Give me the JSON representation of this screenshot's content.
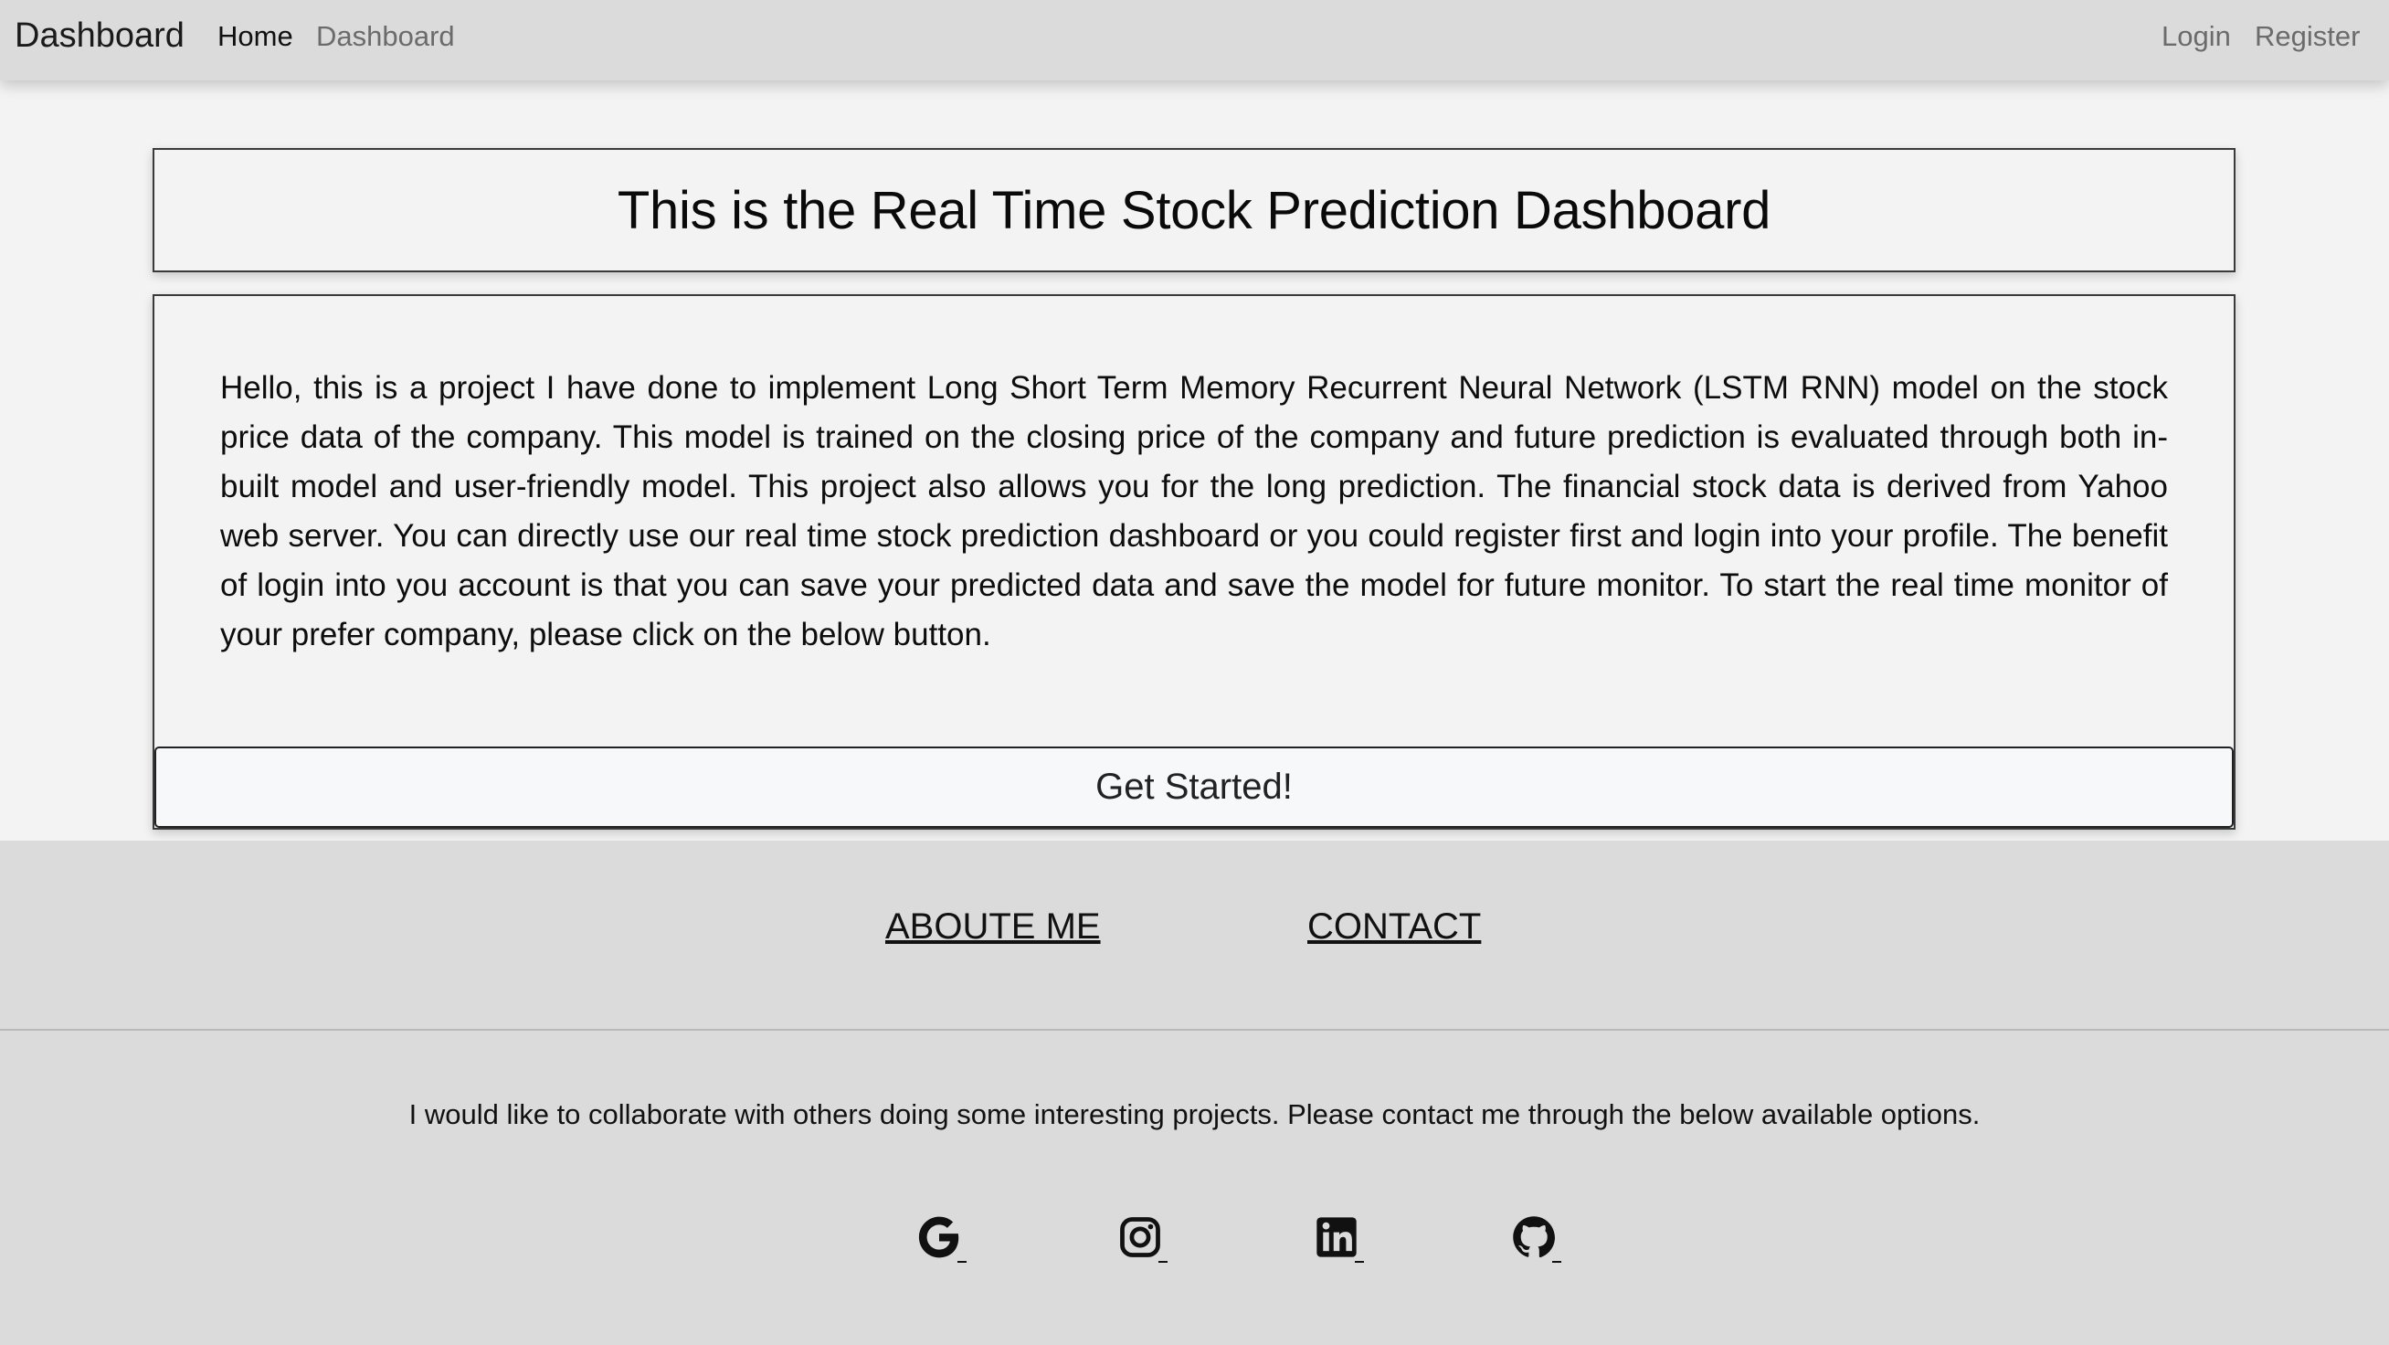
{
  "navbar": {
    "brand": "Dashboard",
    "links": [
      "Home",
      "Dashboard"
    ],
    "auth": [
      "Login",
      "Register"
    ]
  },
  "main": {
    "title": "This is the Real Time Stock Prediction Dashboard",
    "intro": "Hello, this is a project I have done to implement Long Short Term Memory Recurrent Neural Network (LSTM RNN) model on the stock price data of the company. This model is trained on the closing price of the company and future prediction is evaluated through both in-built model and user-friendly model. This project also allows you for the long prediction. The financial stock data is derived from Yahoo web server. You can directly use our real time stock prediction dashboard or you could register first and login into your profile. The benefit of login into you account is that you can save your predicted data and save the model for future monitor. To start the real time monitor of your prefer company, please click on the below button.",
    "cta_label": "Get Started!"
  },
  "footer": {
    "links": [
      "ABOUTE ME",
      "CONTACT"
    ],
    "text": "I would like to collaborate with others doing some interesting projects. Please contact me through the below available options.",
    "social_icons": [
      "google-icon",
      "instagram-icon",
      "linkedin-icon",
      "github-icon"
    ]
  }
}
